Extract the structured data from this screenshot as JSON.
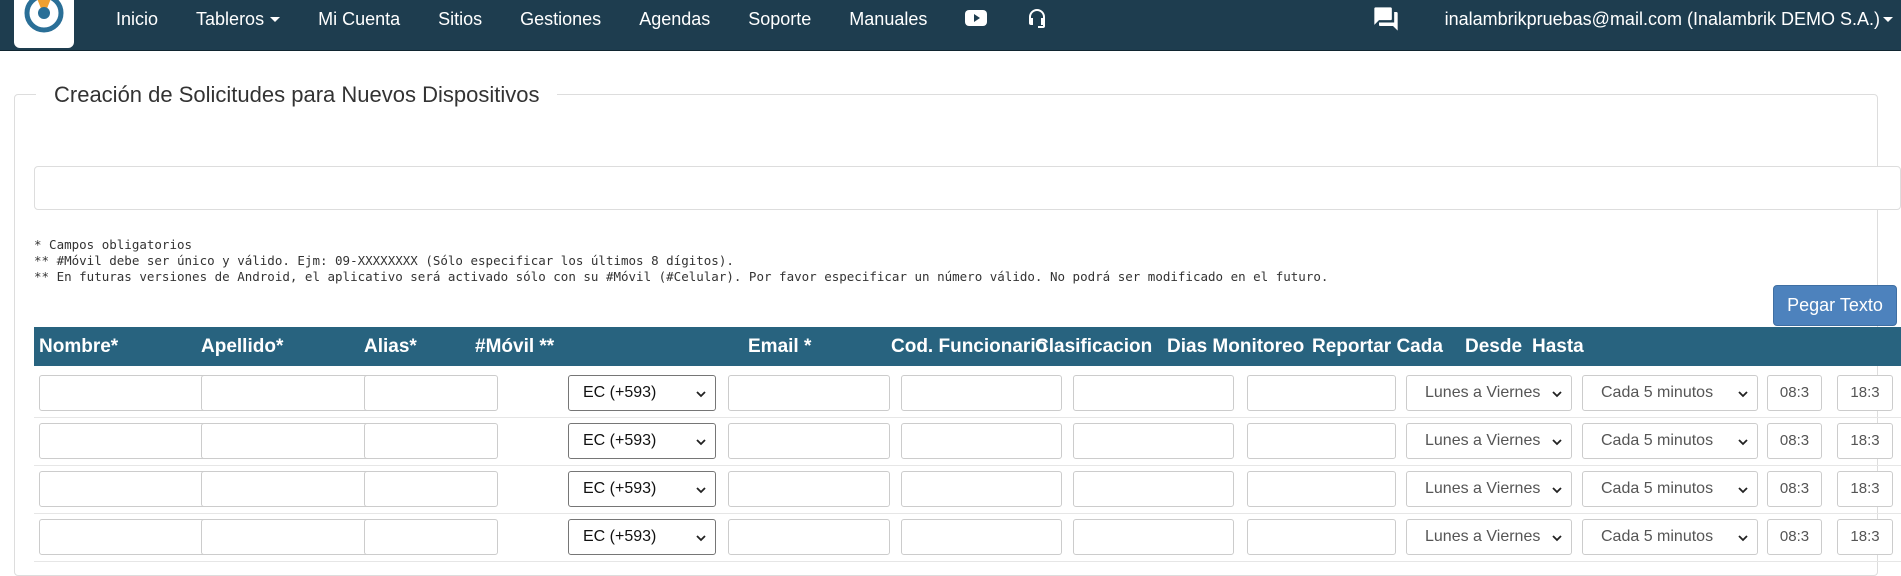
{
  "nav": {
    "items": [
      {
        "label": "Inicio",
        "dropdown": false
      },
      {
        "label": "Tableros",
        "dropdown": true
      },
      {
        "label": "Mi Cuenta",
        "dropdown": false
      },
      {
        "label": "Sitios",
        "dropdown": false
      },
      {
        "label": "Gestiones",
        "dropdown": false
      },
      {
        "label": "Agendas",
        "dropdown": false
      },
      {
        "label": "Soporte",
        "dropdown": false
      },
      {
        "label": "Manuales",
        "dropdown": false
      }
    ],
    "icons": [
      "youtube-icon",
      "headset-icon"
    ],
    "chat_icon": "chat-icon",
    "user": "inalambrikpruebas@mail.com (Inalambrik DEMO S.A.)"
  },
  "page": {
    "title": "Creación de Solicitudes para Nuevos Dispositivos",
    "notes": [
      "* Campos obligatorios",
      "** #Móvil debe ser único y válido. Ejm: 09-XXXXXXXX (Sólo especificar los últimos 8 dígitos).",
      "** En futuras versiones de Android, el aplicativo será activado sólo con su #Móvil (#Celular). Por favor especificar un número válido. No podrá ser modificado en el futuro."
    ],
    "paste_button": "Pegar Texto"
  },
  "table": {
    "headers": [
      "Nombre*",
      "Apellido*",
      "Alias*",
      "#Móvil **",
      "Email *",
      "Cod. Funcionario",
      "Clasificacion",
      "Dias Monitoreo",
      "Reportar Cada",
      "Desde",
      "Hasta"
    ],
    "rows": [
      {
        "country_code": "EC (+593)",
        "dias": "Lunes a Viernes",
        "reportar": "Cada 5 minutos",
        "desde": "08:3",
        "hasta": "18:3"
      },
      {
        "country_code": "EC (+593)",
        "dias": "Lunes a Viernes",
        "reportar": "Cada 5 minutos",
        "desde": "08:3",
        "hasta": "18:3"
      },
      {
        "country_code": "EC (+593)",
        "dias": "Lunes a Viernes",
        "reportar": "Cada 5 minutos",
        "desde": "08:3",
        "hasta": "18:3"
      },
      {
        "country_code": "EC (+593)",
        "dias": "Lunes a Viernes",
        "reportar": "Cada 5 minutos",
        "desde": "08:3",
        "hasta": "18:3"
      }
    ]
  },
  "colors": {
    "navbar": "#1e3d4f",
    "table_header": "#28637f",
    "button": "#4d82bd",
    "logo_orange": "#f0a030",
    "logo_blue": "#2a6f97"
  }
}
